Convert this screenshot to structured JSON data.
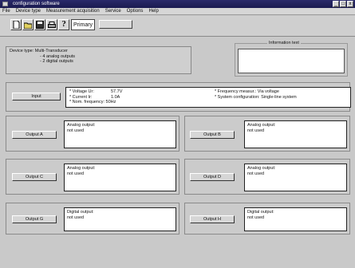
{
  "window": {
    "title": "configuration software",
    "minimize": "_",
    "maximize": "□",
    "close": "x"
  },
  "menu": [
    "File",
    "Device type",
    "Measurement acquisition",
    "Service",
    "Options",
    "Help"
  ],
  "toolbar": {
    "primary_label": "Primary",
    "icons": [
      "new-document-icon",
      "open-folder-icon",
      "printer-icon",
      "help-icon"
    ]
  },
  "device": {
    "type_line": "Device type: Multi-Transducer",
    "line2": "- 4 analog outputs",
    "line3": "- 2 digital outputs"
  },
  "info": {
    "legend": "Information text",
    "text": ""
  },
  "input": {
    "button": "Input",
    "voltage_label": "* Voltage Ur:",
    "voltage_value": "57.7V",
    "current_label": "* Current Ir:",
    "current_value": "1.0A",
    "freq_line": "* Nom. frequency: 50Hz",
    "freq_measure": "* Frequency measur.: Via voltage",
    "system_config": "* System configuration: Single-line system"
  },
  "outputs": [
    {
      "button": "Output A",
      "type": "Analog output:",
      "status": "not used"
    },
    {
      "button": "Output B",
      "type": "Analog output:",
      "status": "not used"
    },
    {
      "button": "Output C",
      "type": "Analog output:",
      "status": "not used"
    },
    {
      "button": "Output D",
      "type": "Analog output:",
      "status": "not used"
    },
    {
      "button": "Output G",
      "type": "Digital output:",
      "status": "not used"
    },
    {
      "button": "Output H",
      "type": "Digital output:",
      "status": "not used"
    }
  ]
}
